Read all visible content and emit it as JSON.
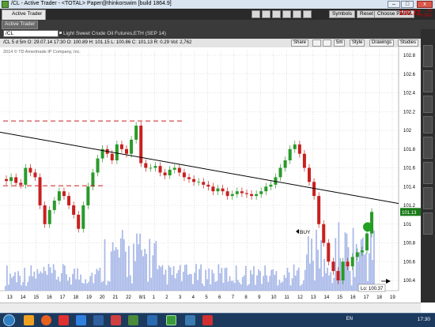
{
  "window": {
    "title": "/CL - Active Trader - <TOTAL> Paper@thinkorswim [build 1864.9]"
  },
  "toolbar": {
    "tab_label": "Active Trader",
    "symbols_label": "Symbols",
    "reset_label": "Reset",
    "preset_label": "Choose Preset",
    "last_price": "100.72",
    "change_line1": "-.26",
    "change_line2": "-0.26%"
  },
  "panel": {
    "tab_label": "Active Trader"
  },
  "symbol": {
    "value": "/CL",
    "description": "Light Sweet Crude Oil Futures,ETH (SEP 14)"
  },
  "chart_header": {
    "info": "/CL 5 d 5m   O: 29.07.14 17:30   O: 100.89   H: 101.15   L: 100.86   C: 101.13   R: 0.29   Vol: 2,762",
    "share_label": "Share",
    "timeframe_label": "5m",
    "style_label": "Style",
    "drawings_label": "Drawings",
    "studies_label": "Studies"
  },
  "chart": {
    "copyright": "2014 © TD Ameritrade IP Company, Inc.",
    "buy_label": "BUY",
    "low_label": "Lo: 100.37",
    "last_tag": "101.13",
    "colors": {
      "up": "#2a9a2a",
      "down": "#c82020",
      "volume": "#a8b8e8",
      "red_line": "#cc2020",
      "trend": "#000000",
      "tag": "#1a7a1a"
    }
  },
  "chart_data": {
    "type": "candlestick",
    "symbol": "/CL",
    "y_ticks": [
      "102.8",
      "102.6",
      "102.4",
      "102.2",
      "102",
      "101.8",
      "101.6",
      "101.4",
      "101.2",
      "101",
      "100.8",
      "100.6",
      "100.4"
    ],
    "x_ticks": [
      "13",
      "14",
      "15",
      "16",
      "17",
      "18",
      "19",
      "20",
      "21",
      "22",
      "8/1",
      "1",
      "2",
      "3",
      "4",
      "5",
      "6",
      "7",
      "8",
      "9",
      "10",
      "11",
      "12",
      "13",
      "14",
      "15",
      "16",
      "17",
      "18",
      "19"
    ],
    "ylim": [
      100.3,
      102.85
    ],
    "close": [
      101.46,
      101.5,
      101.44,
      101.42,
      101.6,
      101.55,
      101.5,
      101.2,
      101.0,
      101.15,
      101.25,
      101.35,
      101.3,
      101.2,
      101.1,
      100.95,
      101.2,
      101.4,
      101.55,
      101.7,
      101.8,
      101.75,
      101.68,
      101.85,
      101.8,
      101.75,
      101.9,
      102.05,
      101.65,
      101.6,
      101.6,
      101.62,
      101.55,
      101.52,
      101.58,
      101.6,
      101.55,
      101.5,
      101.48,
      101.45,
      101.45,
      101.42,
      101.4,
      101.35,
      101.38,
      101.35,
      101.3,
      101.32,
      101.35,
      101.33,
      101.32,
      101.3,
      101.32,
      101.35,
      101.4,
      101.42,
      101.5,
      101.6,
      101.68,
      101.8,
      101.85,
      101.75,
      101.6,
      101.45,
      101.3,
      101.0,
      100.8,
      100.6,
      100.5,
      100.4,
      100.6,
      100.55,
      100.65,
      100.7,
      100.72,
      100.9,
      101.13
    ],
    "annotations": [
      "Lo: 100.37",
      "BUY"
    ]
  }
}
